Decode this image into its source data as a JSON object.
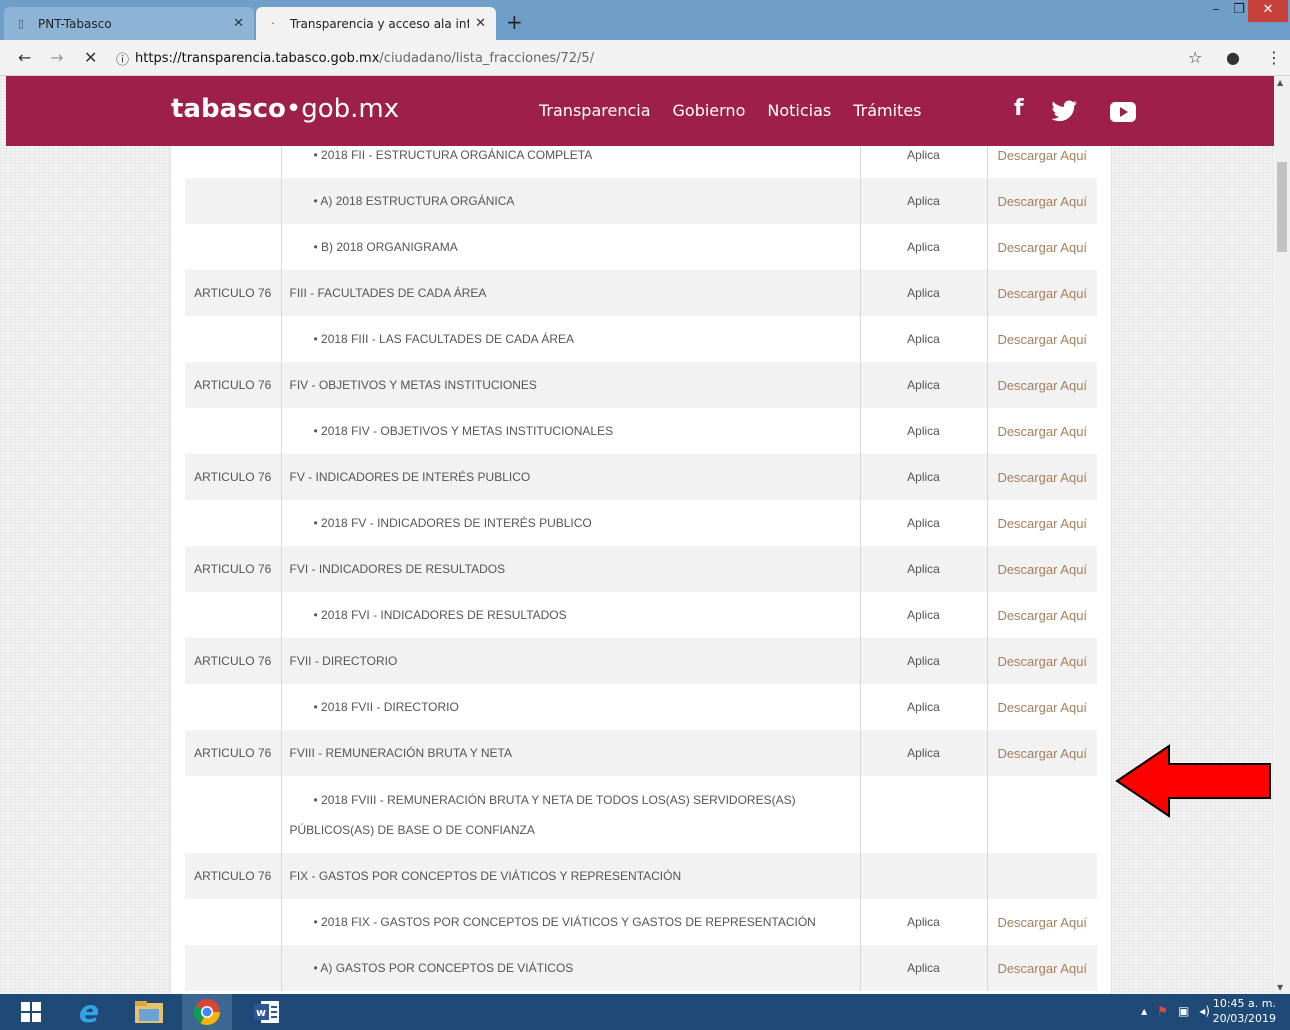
{
  "browser": {
    "tabs": [
      {
        "title": "PNT-Tabasco"
      },
      {
        "title": "Transparencia y acceso ala inform"
      }
    ],
    "url_host": "https://transparencia.tabasco.gob.mx",
    "url_path": "/ciudadano/lista_fracciones/72/5/"
  },
  "site": {
    "logo_bold": "tabasco",
    "logo_rest": "gob.mx",
    "nav": [
      "Transparencia",
      "Gobierno",
      "Noticias",
      "Trámites"
    ]
  },
  "rows": [
    {
      "art": "",
      "frac": "• 2018 FII - ESTRUCTURA ORGÁNICA COMPLETA",
      "aplica": "Aplica",
      "link": "Descargar Aquí"
    },
    {
      "art": "",
      "frac": "• A) 2018 ESTRUCTURA ORGÁNICA",
      "aplica": "Aplica",
      "link": "Descargar Aquí"
    },
    {
      "art": "",
      "frac": "• B) 2018 ORGANIGRAMA",
      "aplica": "Aplica",
      "link": "Descargar Aquí"
    },
    {
      "art": "ARTICULO 76",
      "frac": "FIII - FACULTADES DE CADA ÁREA",
      "aplica": "Aplica",
      "link": "Descargar Aquí"
    },
    {
      "art": "",
      "frac": "• 2018 FIII - LAS FACULTADES DE CADA ÁREA",
      "aplica": "Aplica",
      "link": "Descargar Aquí"
    },
    {
      "art": "ARTICULO 76",
      "frac": "FIV - OBJETIVOS Y METAS INSTITUCIONES",
      "aplica": "Aplica",
      "link": "Descargar Aquí"
    },
    {
      "art": "",
      "frac": "• 2018 FIV - OBJETIVOS Y METAS INSTITUCIONALES",
      "aplica": "Aplica",
      "link": "Descargar Aquí"
    },
    {
      "art": "ARTICULO 76",
      "frac": "FV - INDICADORES DE INTERÉS PUBLICO",
      "aplica": "Aplica",
      "link": "Descargar Aquí"
    },
    {
      "art": "",
      "frac": "• 2018 FV - INDICADORES DE INTERÉS PUBLICO",
      "aplica": "Aplica",
      "link": "Descargar Aquí"
    },
    {
      "art": "ARTICULO 76",
      "frac": "FVI - INDICADORES DE RESULTADOS",
      "aplica": "Aplica",
      "link": "Descargar Aquí"
    },
    {
      "art": "",
      "frac": "• 2018 FVI - INDICADORES DE RESULTADOS",
      "aplica": "Aplica",
      "link": "Descargar Aquí"
    },
    {
      "art": "ARTICULO 76",
      "frac": "FVII - DIRECTORIO",
      "aplica": "Aplica",
      "link": "Descargar Aquí"
    },
    {
      "art": "",
      "frac": "• 2018 FVII - DIRECTORIO",
      "aplica": "Aplica",
      "link": "Descargar Aquí"
    },
    {
      "art": "ARTICULO 76",
      "frac": "FVIII - REMUNERACIÓN BRUTA Y NETA",
      "aplica": "Aplica",
      "link": "Descargar Aquí"
    },
    {
      "art": "",
      "frac_line1": "• 2018 FVIII - REMUNERACIÓN BRUTA Y NETA DE TODOS LOS(AS) SERVIDORES(AS)",
      "frac_line2": "PÚBLICOS(AS) DE BASE O DE CONFIANZA",
      "aplica": "",
      "link": ""
    },
    {
      "art": "ARTICULO 76",
      "frac": "FIX - GASTOS POR CONCEPTOS DE VIÁTICOS Y REPRESENTACIÓN",
      "aplica": "",
      "link": ""
    },
    {
      "art": "",
      "frac": "• 2018 FIX - GASTOS POR CONCEPTOS DE VIÁTICOS Y GASTOS DE REPRESENTACIÓN",
      "aplica": "Aplica",
      "link": "Descargar Aquí"
    },
    {
      "art": "",
      "frac": "• A) GASTOS POR CONCEPTOS DE VIÁTICOS",
      "aplica": "Aplica",
      "link": "Descargar Aquí"
    }
  ],
  "taskbar": {
    "time": "10:45 a. m.",
    "date": "20/03/2019"
  },
  "colors": {
    "header": "#9e1f4a",
    "link": "#a57f5c",
    "arrow": "#ff0000"
  }
}
